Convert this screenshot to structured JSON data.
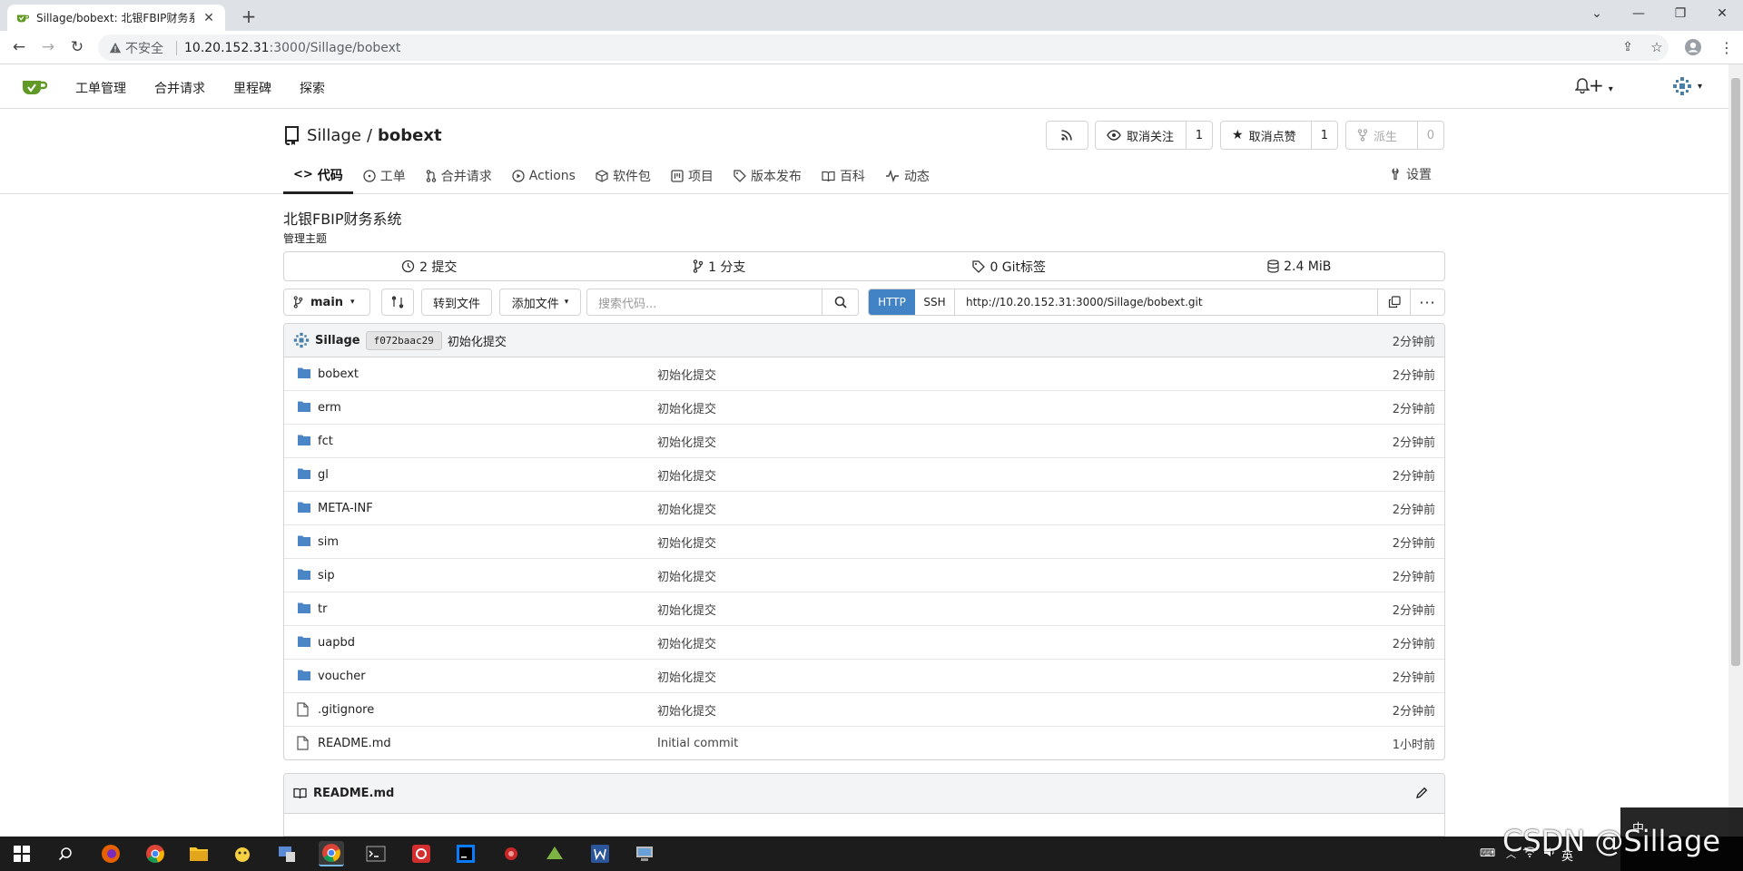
{
  "browser": {
    "tab_title": "Sillage/bobext: 北银FBIP财务系",
    "address_insecure": "不安全",
    "address_host": "10.20.152.31",
    "address_rest": ":3000/Sillage/bobext"
  },
  "nav": {
    "items": [
      "工单管理",
      "合并请求",
      "里程碑",
      "探索"
    ]
  },
  "repo": {
    "owner": "Sillage",
    "separator": "/",
    "name": "bobext",
    "unwatch_label": "取消关注",
    "watch_count": "1",
    "unstar_label": "取消点赞",
    "star_count": "1",
    "fork_label": "派生",
    "fork_count": "0",
    "description": "北银FBIP财务系统",
    "topic_link": "管理主题"
  },
  "tabs": [
    {
      "label": "代码"
    },
    {
      "label": "工单"
    },
    {
      "label": "合并请求"
    },
    {
      "label": "Actions"
    },
    {
      "label": "软件包"
    },
    {
      "label": "项目"
    },
    {
      "label": "版本发布"
    },
    {
      "label": "百科"
    },
    {
      "label": "动态"
    }
  ],
  "settings_label": "设置",
  "stats": {
    "commits": "2 提交",
    "branches": "1 分支",
    "tags": "0 Git标签",
    "size": "2.4 MiB"
  },
  "toolbar": {
    "branch": "main",
    "goto_file": "转到文件",
    "add_file": "添加文件",
    "search_placeholder": "搜索代码...",
    "http": "HTTP",
    "ssh": "SSH",
    "clone_url": "http://10.20.152.31:3000/Sillage/bobext.git"
  },
  "latest_commit": {
    "author": "Sillage",
    "sha": "f072baac29",
    "message": "初始化提交",
    "time": "2分钟前"
  },
  "files": [
    {
      "type": "folder",
      "name": "bobext",
      "message": "初始化提交",
      "time": "2分钟前"
    },
    {
      "type": "folder",
      "name": "erm",
      "message": "初始化提交",
      "time": "2分钟前"
    },
    {
      "type": "folder",
      "name": "fct",
      "message": "初始化提交",
      "time": "2分钟前"
    },
    {
      "type": "folder",
      "name": "gl",
      "message": "初始化提交",
      "time": "2分钟前"
    },
    {
      "type": "folder",
      "name": "META-INF",
      "message": "初始化提交",
      "time": "2分钟前"
    },
    {
      "type": "folder",
      "name": "sim",
      "message": "初始化提交",
      "time": "2分钟前"
    },
    {
      "type": "folder",
      "name": "sip",
      "message": "初始化提交",
      "time": "2分钟前"
    },
    {
      "type": "folder",
      "name": "tr",
      "message": "初始化提交",
      "time": "2分钟前"
    },
    {
      "type": "folder",
      "name": "uapbd",
      "message": "初始化提交",
      "time": "2分钟前"
    },
    {
      "type": "folder",
      "name": "voucher",
      "message": "初始化提交",
      "time": "2分钟前"
    },
    {
      "type": "file",
      "name": ".gitignore",
      "message": "初始化提交",
      "time": "2分钟前"
    },
    {
      "type": "file",
      "name": "README.md",
      "message": "Initial commit",
      "time": "1小时前"
    }
  ],
  "readme": {
    "title": "README.md"
  },
  "taskbar": {
    "ime_lang": "英",
    "ime_char": "中"
  },
  "watermark": "CSDN @Sillage",
  "colors": {
    "accent": "#4183c4",
    "folder": "#4a86c5",
    "gitea_green": "#609926"
  }
}
